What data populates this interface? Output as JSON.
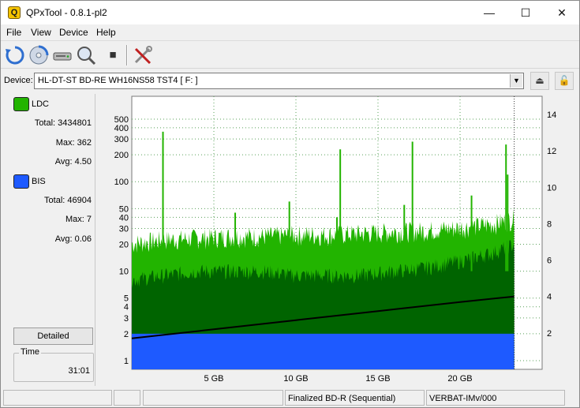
{
  "window": {
    "title": "QPxTool - 0.8.1-pl2",
    "app_icon_letter": "Q",
    "minimize_glyph": "—",
    "maximize_glyph": "☐",
    "close_glyph": "✕"
  },
  "menu": {
    "items": [
      {
        "label": "File"
      },
      {
        "label": "View"
      },
      {
        "label": "Device"
      },
      {
        "label": "Help"
      }
    ]
  },
  "toolbar": {
    "icons": [
      "refresh-icon",
      "disc-scan-icon",
      "drive-icon",
      "magnifier-disc-icon",
      "stop-icon",
      "tools-icon"
    ],
    "stop_glyph": "■"
  },
  "device": {
    "label": "Device:",
    "selected": "HL-DT-ST BD-RE  WH16NS58  TST4 [ F: ]",
    "dropdown_glyph": "▼",
    "eject_glyph": "⏏",
    "lock_glyph": "🔓"
  },
  "stats": {
    "ldc": {
      "name": "LDC",
      "color": "#22b400",
      "total_label": "Total:",
      "total_value": "3434801",
      "max_label": "Max:",
      "max_value": "362",
      "avg_label": "Avg:",
      "avg_value": "4.50"
    },
    "bis": {
      "name": "BIS",
      "color": "#1e5aff",
      "total_label": "Total:",
      "total_value": "46904",
      "max_label": "Max:",
      "max_value": "7",
      "avg_label": "Avg:",
      "avg_value": "0.06"
    },
    "detailed_label": "Detailed",
    "time_label": "Time",
    "time_value": "31:01"
  },
  "chart_data": {
    "type": "area",
    "x_unit": "GB",
    "x_range": [
      0,
      25
    ],
    "x_ticks": [
      {
        "v": 5,
        "label": "5 GB"
      },
      {
        "v": 10,
        "label": "10 GB"
      },
      {
        "v": 15,
        "label": "15 GB"
      },
      {
        "v": 20,
        "label": "20 GB"
      }
    ],
    "y_left_scale": "log",
    "y_left_range": [
      0.8,
      900
    ],
    "y_left_ticks": [
      1,
      2,
      3,
      4,
      5,
      10,
      20,
      30,
      40,
      50,
      100,
      200,
      300,
      400,
      500
    ],
    "y_right_range": [
      0,
      15
    ],
    "y_right_ticks": [
      2,
      4,
      6,
      8,
      10,
      12,
      14
    ],
    "grid": true,
    "data_end_gb": 23.3,
    "series": [
      {
        "name": "LDC",
        "color": "#22b400",
        "x": [
          0,
          2,
          4,
          6,
          8,
          10,
          12,
          14,
          16,
          18,
          20,
          22,
          23.3
        ],
        "y": [
          20,
          22,
          23,
          24,
          24,
          25,
          25,
          26,
          27,
          28,
          30,
          33,
          38
        ]
      },
      {
        "name": "LDC",
        "color": "#006400",
        "x": [
          0,
          2,
          4,
          6,
          8,
          10,
          12,
          14,
          16,
          18,
          20,
          22,
          23.3
        ],
        "y": [
          8,
          9,
          10,
          10,
          10,
          9,
          9,
          9,
          10,
          11,
          13,
          16,
          20
        ]
      },
      {
        "name": "BIS",
        "color": "#1e5aff",
        "x": [
          0,
          23.3
        ],
        "y": [
          2,
          2
        ]
      }
    ],
    "ldc_spikes": [
      {
        "x": 1.9,
        "y": 362
      },
      {
        "x": 6.3,
        "y": 45
      },
      {
        "x": 9.6,
        "y": 60
      },
      {
        "x": 12.5,
        "y": 40
      },
      {
        "x": 12.7,
        "y": 230
      },
      {
        "x": 16.6,
        "y": 55
      },
      {
        "x": 17.1,
        "y": 280
      },
      {
        "x": 20.7,
        "y": 70
      },
      {
        "x": 22.8,
        "y": 260
      },
      {
        "x": 22.9,
        "y": 120
      }
    ],
    "speed_line": {
      "name": "Speed",
      "color": "#000000",
      "x": [
        0,
        5,
        10,
        15,
        20,
        23.3
      ],
      "y": [
        1.7,
        2.2,
        2.7,
        3.2,
        3.7,
        4.0
      ]
    }
  },
  "status": {
    "pane1": "",
    "pane2": "",
    "pane3": "",
    "disc_type": "Finalized BD-R (Sequential)",
    "media_id": "VERBAT-IMv/000"
  }
}
